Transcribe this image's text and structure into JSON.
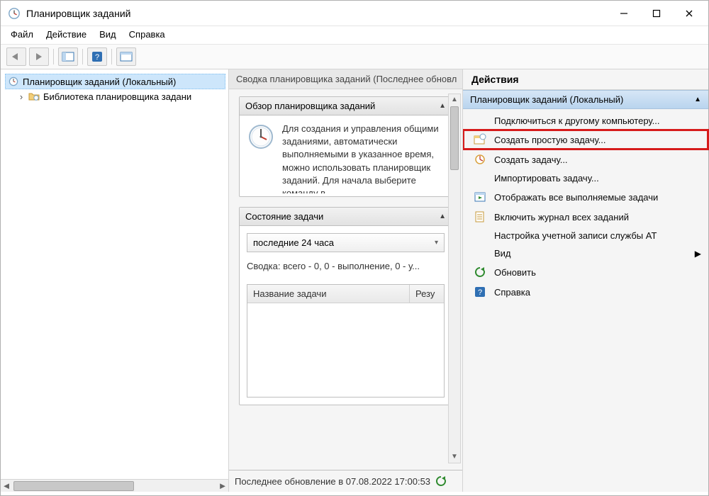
{
  "window": {
    "title": "Планировщик заданий"
  },
  "menu": {
    "file": "Файл",
    "action": "Действие",
    "view": "Вид",
    "help": "Справка"
  },
  "tree": {
    "root": "Планировщик заданий (Локальный)",
    "library": "Библиотека планировщика задани"
  },
  "center": {
    "header": "Сводка планировщика заданий (Последнее обновл",
    "overview_title": "Обзор планировщика заданий",
    "overview_text": "Для создания и управления общими заданиями, автоматически выполняемыми в указанное время, можно использовать планировщик заданий. Для начала выберите команду в",
    "status_title": "Состояние задачи",
    "period": "последние 24 часа",
    "summary": "Сводка: всего - 0, 0 - выполнение, 0 - у...",
    "col_name": "Название задачи",
    "col_result": "Резу",
    "last_update": "Последнее обновление в 07.08.2022 17:00:53"
  },
  "right": {
    "header": "Действия",
    "context": "Планировщик заданий (Локальный)",
    "items": {
      "connect": "Подключиться к другому компьютеру...",
      "create_basic": "Создать простую задачу...",
      "create": "Создать задачу...",
      "import": "Импортировать задачу...",
      "show_running": "Отображать все выполняемые задачи",
      "enable_history": "Включить журнал всех заданий",
      "at_service": "Настройка учетной записи службы AT",
      "view": "Вид",
      "refresh": "Обновить",
      "help": "Справка"
    }
  }
}
